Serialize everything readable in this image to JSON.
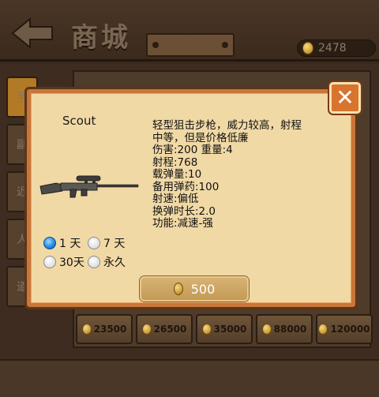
{
  "header": {
    "title": "商城",
    "currency_value": "2478"
  },
  "side_tabs": [
    "手",
    "副",
    "近",
    "人",
    "道"
  ],
  "price_row": [
    "23500",
    "26500",
    "35000",
    "88000",
    "120000"
  ],
  "dialog": {
    "weapon_name": "Scout",
    "description_lines": [
      "轻型狙击步枪，威力较高，射程",
      "中等，但是价格低廉",
      "伤害:200 重量:4",
      "射程:768",
      "载弹量:10",
      "备用弹药:100",
      "射速:偏低",
      "换弹时长:2.0",
      "功能:减速-强"
    ],
    "duration_options": [
      {
        "label": "1 天",
        "selected": true
      },
      {
        "label": "7 天",
        "selected": false
      },
      {
        "label": "30天",
        "selected": false
      },
      {
        "label": "永久",
        "selected": false
      }
    ],
    "buy_price": "500"
  },
  "colors": {
    "dialog_bg": "#f1d9a6",
    "dialog_border": "#c9763a",
    "close_button": "#d9742e",
    "radio_selected": "#1e86e0"
  },
  "icons": {
    "back": "back-arrow-icon",
    "close": "close-icon",
    "coin": "coin-icon",
    "weapon": "sniper-rifle-icon"
  }
}
